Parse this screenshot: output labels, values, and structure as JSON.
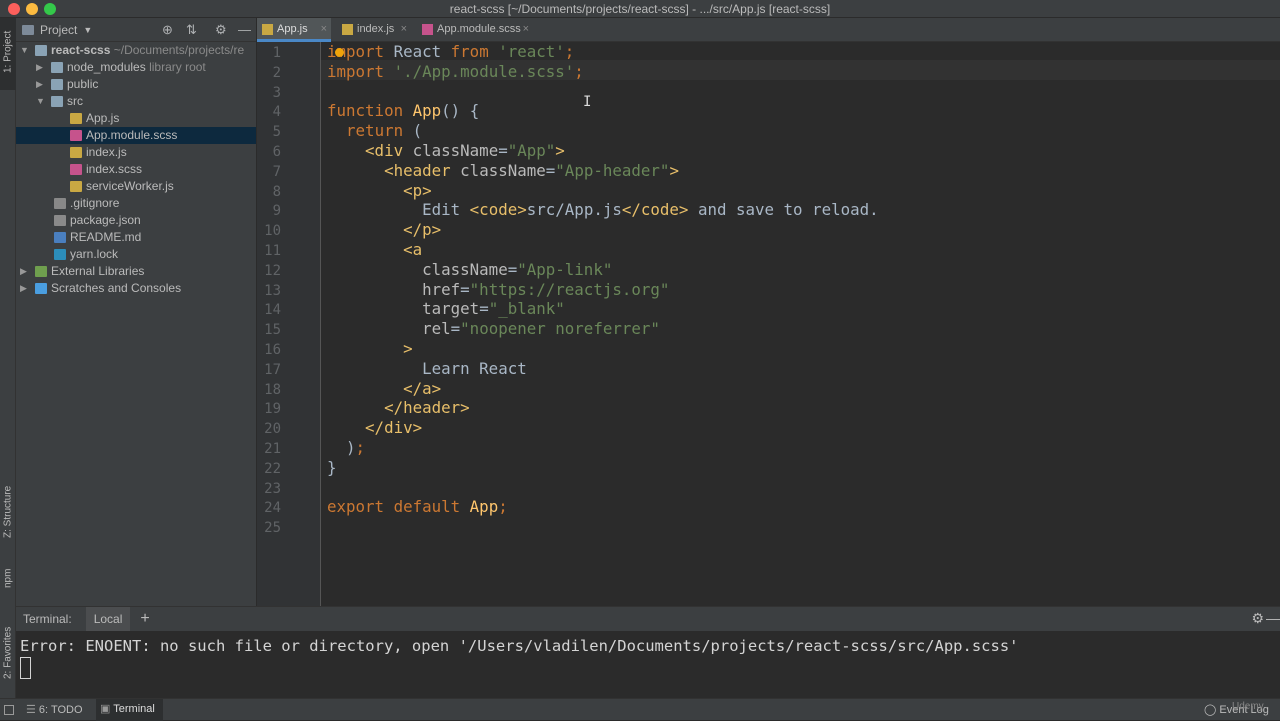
{
  "window": {
    "title": "react-scss [~/Documents/projects/react-scss] - .../src/App.js [react-scss]"
  },
  "side_strip": {
    "project": "1: Project",
    "structure": "Z: Structure",
    "npm": "npm",
    "favorites": "2: Favorites"
  },
  "project": {
    "header_label": "Project",
    "tree": [
      {
        "label": "react-scss",
        "suffix": "~/Documents/projects/re",
        "indent": 0,
        "type": "folder",
        "expanded": true,
        "bold": true
      },
      {
        "label": "node_modules",
        "suffix": "library root",
        "indent": 1,
        "type": "folder",
        "expanded": false
      },
      {
        "label": "public",
        "suffix": "",
        "indent": 1,
        "type": "folder",
        "expanded": false
      },
      {
        "label": "src",
        "suffix": "",
        "indent": 1,
        "type": "folder",
        "expanded": true
      },
      {
        "label": "App.js",
        "suffix": "",
        "indent": 2,
        "type": "js"
      },
      {
        "label": "App.module.scss",
        "suffix": "",
        "indent": 2,
        "type": "scss",
        "selected": true
      },
      {
        "label": "index.js",
        "suffix": "",
        "indent": 2,
        "type": "js"
      },
      {
        "label": "index.scss",
        "suffix": "",
        "indent": 2,
        "type": "scss"
      },
      {
        "label": "serviceWorker.js",
        "suffix": "",
        "indent": 2,
        "type": "js"
      },
      {
        "label": ".gitignore",
        "suffix": "",
        "indent": 1,
        "type": "file"
      },
      {
        "label": "package.json",
        "suffix": "",
        "indent": 1,
        "type": "json"
      },
      {
        "label": "README.md",
        "suffix": "",
        "indent": 1,
        "type": "md"
      },
      {
        "label": "yarn.lock",
        "suffix": "",
        "indent": 1,
        "type": "yarn"
      },
      {
        "label": "External Libraries",
        "suffix": "",
        "indent": 0,
        "type": "lib",
        "expanded": false
      },
      {
        "label": "Scratches and Consoles",
        "suffix": "",
        "indent": 0,
        "type": "scratch",
        "expanded": false
      }
    ]
  },
  "tabs": [
    {
      "label": "App.js",
      "active": true,
      "icon": "js"
    },
    {
      "label": "index.js",
      "active": false,
      "icon": "js"
    },
    {
      "label": "App.module.scss",
      "active": false,
      "icon": "scss"
    }
  ],
  "code": {
    "line_numbers": [
      "1",
      "2",
      "3",
      "4",
      "5",
      "6",
      "7",
      "8",
      "9",
      "10",
      "11",
      "12",
      "13",
      "14",
      "15",
      "16",
      "17",
      "18",
      "19",
      "20",
      "21",
      "22",
      "23",
      "24",
      "25"
    ],
    "lines": [
      [
        [
          "kw",
          "import"
        ],
        [
          "txt",
          " React "
        ],
        [
          "kw",
          "from"
        ],
        [
          "txt",
          " "
        ],
        [
          "str",
          "'react'"
        ],
        [
          "kw",
          ";"
        ]
      ],
      [
        [
          "kw",
          "import"
        ],
        [
          "txt",
          " "
        ],
        [
          "str",
          "'./App.module.scss'"
        ],
        [
          "kw",
          ";"
        ]
      ],
      [],
      [
        [
          "kw",
          "function"
        ],
        [
          "txt",
          " "
        ],
        [
          "fn",
          "App"
        ],
        [
          "txt",
          "() {"
        ]
      ],
      [
        [
          "txt",
          "  "
        ],
        [
          "kw",
          "return"
        ],
        [
          "txt",
          " ("
        ]
      ],
      [
        [
          "txt",
          "    "
        ],
        [
          "tag",
          "<div"
        ],
        [
          "txt",
          " "
        ],
        [
          "attr",
          "className"
        ],
        [
          "txt",
          "="
        ],
        [
          "str",
          "\"App\""
        ],
        [
          "tag",
          ">"
        ]
      ],
      [
        [
          "txt",
          "      "
        ],
        [
          "tag",
          "<header"
        ],
        [
          "txt",
          " "
        ],
        [
          "attr",
          "className"
        ],
        [
          "txt",
          "="
        ],
        [
          "str",
          "\"App-header\""
        ],
        [
          "tag",
          ">"
        ]
      ],
      [
        [
          "txt",
          "        "
        ],
        [
          "tag",
          "<p>"
        ]
      ],
      [
        [
          "txt",
          "          Edit "
        ],
        [
          "tag",
          "<code>"
        ],
        [
          "txt",
          "src/App.js"
        ],
        [
          "tag",
          "</code>"
        ],
        [
          "txt",
          " and save to reload."
        ]
      ],
      [
        [
          "txt",
          "        "
        ],
        [
          "tag",
          "</p>"
        ]
      ],
      [
        [
          "txt",
          "        "
        ],
        [
          "tag",
          "<a"
        ]
      ],
      [
        [
          "txt",
          "          "
        ],
        [
          "attr",
          "className"
        ],
        [
          "txt",
          "="
        ],
        [
          "str",
          "\"App-link\""
        ]
      ],
      [
        [
          "txt",
          "          "
        ],
        [
          "attr",
          "href"
        ],
        [
          "txt",
          "="
        ],
        [
          "str",
          "\"https://reactjs.org\""
        ]
      ],
      [
        [
          "txt",
          "          "
        ],
        [
          "attr",
          "target"
        ],
        [
          "txt",
          "="
        ],
        [
          "str",
          "\"_blank\""
        ]
      ],
      [
        [
          "txt",
          "          "
        ],
        [
          "attr",
          "rel"
        ],
        [
          "txt",
          "="
        ],
        [
          "str",
          "\"noopener noreferrer\""
        ]
      ],
      [
        [
          "txt",
          "        "
        ],
        [
          "tag",
          ">"
        ]
      ],
      [
        [
          "txt",
          "          Learn React"
        ]
      ],
      [
        [
          "txt",
          "        "
        ],
        [
          "tag",
          "</a>"
        ]
      ],
      [
        [
          "txt",
          "      "
        ],
        [
          "tag",
          "</header>"
        ]
      ],
      [
        [
          "txt",
          "    "
        ],
        [
          "tag",
          "</div>"
        ]
      ],
      [
        [
          "txt",
          "  )"
        ],
        [
          "kw",
          ";"
        ]
      ],
      [
        [
          "txt",
          "}"
        ]
      ],
      [],
      [
        [
          "kw",
          "export default"
        ],
        [
          "txt",
          " "
        ],
        [
          "fn",
          "App"
        ],
        [
          "kw",
          ";"
        ]
      ],
      []
    ]
  },
  "terminal": {
    "title": "Terminal:",
    "tab": "Local",
    "add": "+",
    "error": "Error: ENOENT: no such file or directory, open '/Users/vladilen/Documents/projects/react-scss/src/App.scss'"
  },
  "statusbar": {
    "todo": "6: TODO",
    "terminal": "Terminal",
    "event_log": "Event Log",
    "watermark": "Udemy"
  }
}
